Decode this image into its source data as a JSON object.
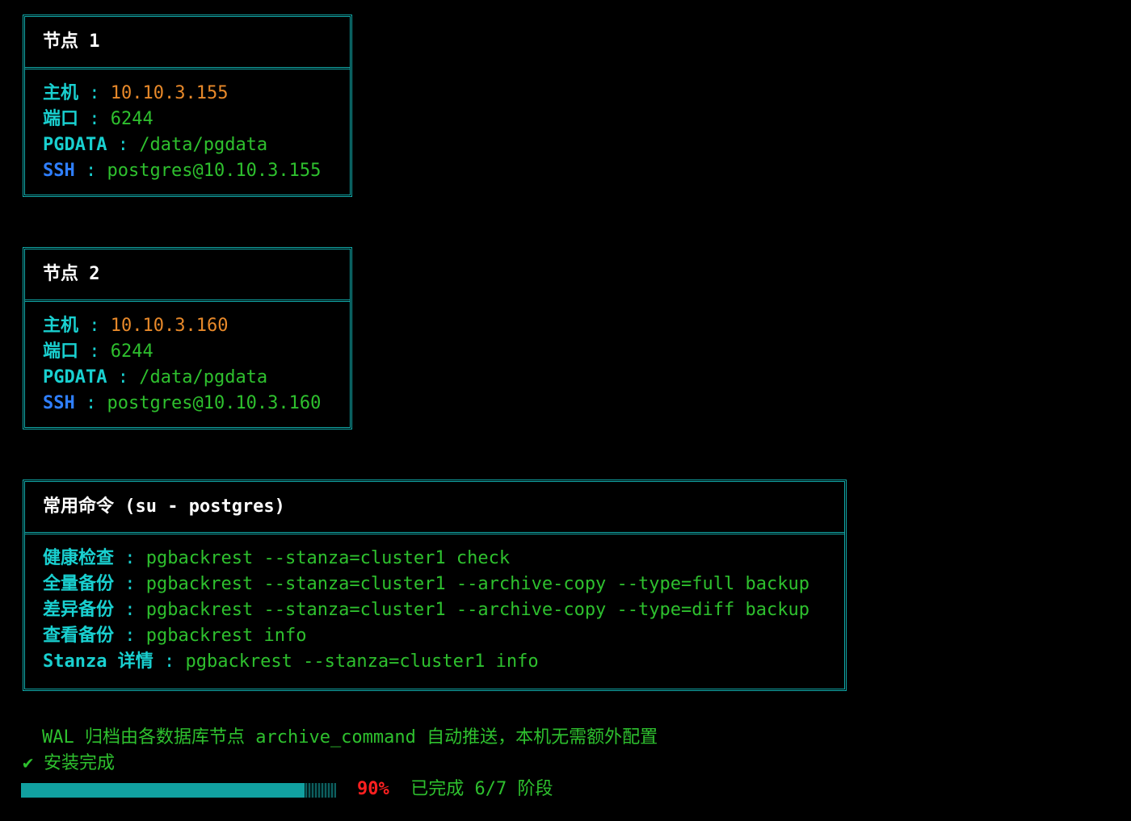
{
  "nodes": [
    {
      "title": "节点 1",
      "host_label": "主机",
      "host": "10.10.3.155",
      "port_label": "端口",
      "port": "6244",
      "pgdata_label": "PGDATA",
      "pgdata": "/data/pgdata",
      "ssh_label": "SSH",
      "ssh": "postgres@10.10.3.155"
    },
    {
      "title": "节点 2",
      "host_label": "主机",
      "host": "10.10.3.160",
      "port_label": "端口",
      "port": "6244",
      "pgdata_label": "PGDATA",
      "pgdata": "/data/pgdata",
      "ssh_label": "SSH",
      "ssh": "postgres@10.10.3.160"
    }
  ],
  "separator": " : ",
  "commands": {
    "title": "常用命令 (su - postgres)",
    "items": [
      {
        "label": "健康检查",
        "cmd": "pgbackrest --stanza=cluster1 check"
      },
      {
        "label": "全量备份",
        "cmd": "pgbackrest --stanza=cluster1 --archive-copy --type=full backup"
      },
      {
        "label": "差异备份",
        "cmd": "pgbackrest --stanza=cluster1 --archive-copy --type=diff backup"
      },
      {
        "label": "查看备份",
        "cmd": "pgbackrest info"
      },
      {
        "label": "Stanza 详情",
        "cmd": "pgbackrest --stanza=cluster1 info"
      }
    ]
  },
  "wal_note": "WAL 归档由各数据库节点 archive_command 自动推送，本机无需额外配置",
  "install_done": "安装完成",
  "check_icon": "✔",
  "progress": {
    "percent_label": "90%",
    "fraction": 0.9,
    "stage_text": "已完成 6/7 阶段"
  },
  "colors": {
    "border": "#11a8a8",
    "label_cyan": "#19d0d0",
    "label_blue": "#2f7fff",
    "value_orange": "#e8892a",
    "value_green": "#2ec02e",
    "percent_red": "#ff2020"
  }
}
